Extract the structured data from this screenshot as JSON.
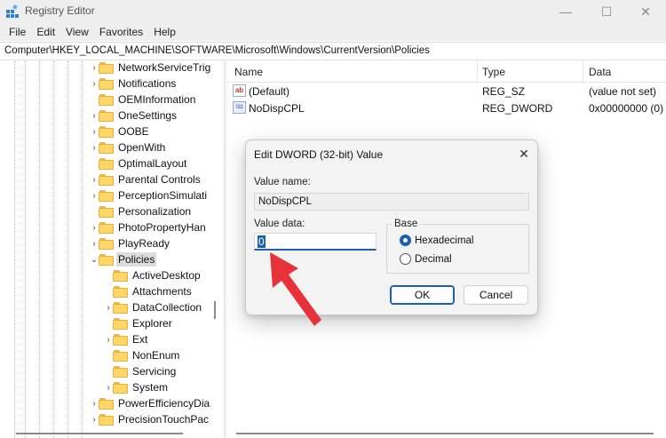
{
  "window": {
    "title": "Registry Editor",
    "controls": {
      "minimize": "—",
      "maximize": "☐",
      "close": "✕"
    }
  },
  "menu": [
    "File",
    "Edit",
    "View",
    "Favorites",
    "Help"
  ],
  "address": "Computer\\HKEY_LOCAL_MACHINE\\SOFTWARE\\Microsoft\\Windows\\CurrentVersion\\Policies",
  "tree": {
    "items": [
      {
        "label": "NetworkServiceTrig",
        "level": 1,
        "expand": "›"
      },
      {
        "label": "Notifications",
        "level": 1,
        "expand": "›"
      },
      {
        "label": "OEMInformation",
        "level": 1,
        "expand": ""
      },
      {
        "label": "OneSettings",
        "level": 1,
        "expand": "›"
      },
      {
        "label": "OOBE",
        "level": 1,
        "expand": "›"
      },
      {
        "label": "OpenWith",
        "level": 1,
        "expand": "›"
      },
      {
        "label": "OptimalLayout",
        "level": 1,
        "expand": ""
      },
      {
        "label": "Parental Controls",
        "level": 1,
        "expand": "›"
      },
      {
        "label": "PerceptionSimulati",
        "level": 1,
        "expand": "›"
      },
      {
        "label": "Personalization",
        "level": 1,
        "expand": ""
      },
      {
        "label": "PhotoPropertyHan",
        "level": 1,
        "expand": "›"
      },
      {
        "label": "PlayReady",
        "level": 1,
        "expand": "›"
      },
      {
        "label": "Policies",
        "level": 1,
        "expand": "⌄",
        "selected": true
      },
      {
        "label": "ActiveDesktop",
        "level": 2,
        "expand": ""
      },
      {
        "label": "Attachments",
        "level": 2,
        "expand": ""
      },
      {
        "label": "DataCollection",
        "level": 2,
        "expand": "›"
      },
      {
        "label": "Explorer",
        "level": 2,
        "expand": ""
      },
      {
        "label": "Ext",
        "level": 2,
        "expand": "›"
      },
      {
        "label": "NonEnum",
        "level": 2,
        "expand": ""
      },
      {
        "label": "Servicing",
        "level": 2,
        "expand": ""
      },
      {
        "label": "System",
        "level": 2,
        "expand": "›"
      },
      {
        "label": "PowerEfficiencyDia",
        "level": 1,
        "expand": "›"
      },
      {
        "label": "PrecisionTouchPac",
        "level": 1,
        "expand": "›"
      }
    ]
  },
  "list": {
    "columns": [
      "Name",
      "Type",
      "Data"
    ],
    "rows": [
      {
        "icon": "string-value-icon",
        "icon_text": "ab",
        "name": "(Default)",
        "type": "REG_SZ",
        "data": "(value not set)"
      },
      {
        "icon": "dword-value-icon",
        "icon_text": "011",
        "name": "NoDispCPL",
        "type": "REG_DWORD",
        "data": "0x00000000 (0)"
      }
    ]
  },
  "dialog": {
    "title": "Edit DWORD (32-bit) Value",
    "close": "✕",
    "value_name_label": "Value name:",
    "value_name": "NoDispCPL",
    "value_data_label": "Value data:",
    "value_data": "0",
    "base_label": "Base",
    "radios": [
      {
        "label": "Hexadecimal",
        "checked": true
      },
      {
        "label": "Decimal",
        "checked": false
      }
    ],
    "ok": "OK",
    "cancel": "Cancel"
  },
  "colors": {
    "accent": "#1b5fb3",
    "annotation_arrow": "#e8323a",
    "folder": "#ffd766"
  }
}
